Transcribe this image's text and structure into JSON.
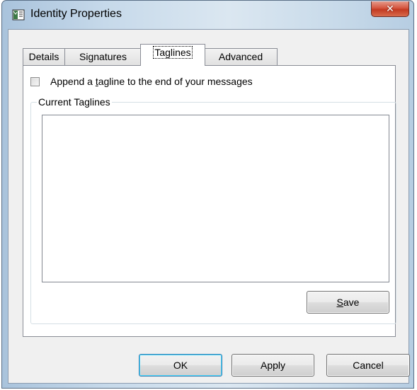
{
  "window": {
    "title": "Identity Properties",
    "close_glyph": "✕",
    "app_icon": "identity-properties-icon"
  },
  "tabs": [
    {
      "label": "Details",
      "active": false
    },
    {
      "label": "Signatures",
      "active": false
    },
    {
      "label": "Taglines",
      "active": true
    },
    {
      "label": "Advanced",
      "active": false
    }
  ],
  "taglines": {
    "append_checkbox": {
      "label_before": "Append a ",
      "label_mnemonic": "t",
      "label_after": "agline to the end of your messages",
      "checked": false
    },
    "group_label": "Current Taglines",
    "taglines_text": "",
    "save_button": {
      "mnemonic": "S",
      "rest": "ave"
    }
  },
  "footer": {
    "ok_label": "OK",
    "apply_label": "Apply",
    "cancel_label": "Cancel"
  },
  "colors": {
    "close_button": "#c84a30",
    "title_gradient_start": "#a9c3dc",
    "client_background": "#f0f0f0",
    "default_button_glow": "#48d6fb"
  }
}
